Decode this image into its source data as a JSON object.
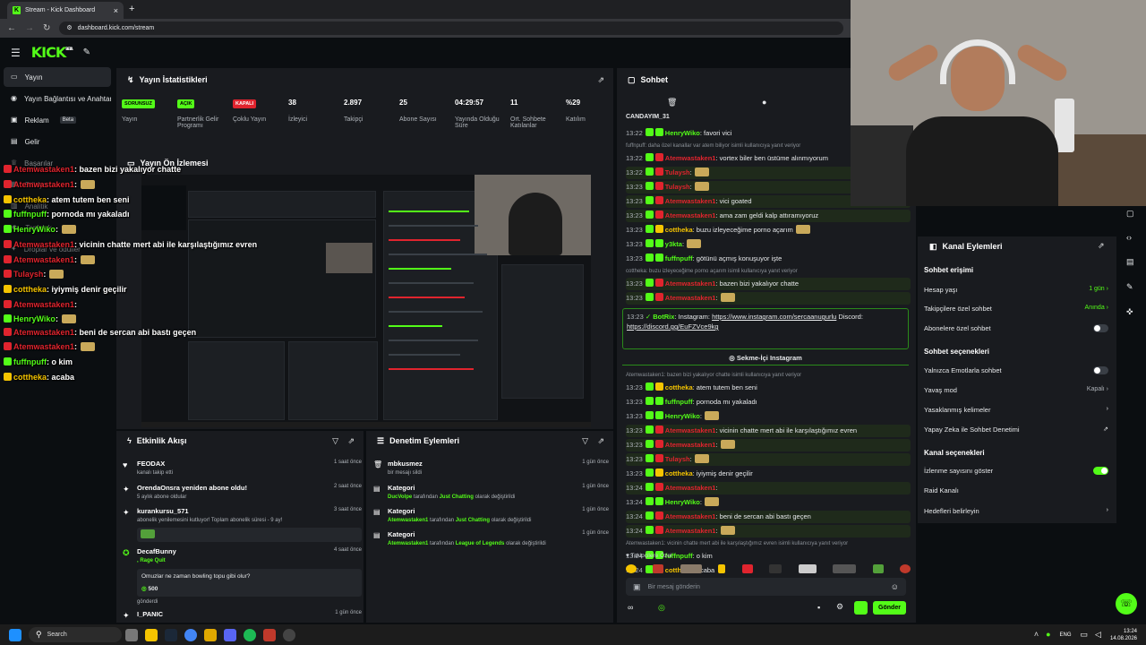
{
  "browser": {
    "tab_title": "Stream - Kick Dashboard",
    "tab_close": "×",
    "new_tab": "+",
    "url": "dashboard.kick.com/stream"
  },
  "app": {
    "logo": "KICK",
    "logo_sup": "BETA"
  },
  "sidebar": {
    "items": [
      {
        "label": "Yayın",
        "icon": "video-icon"
      },
      {
        "label": "Yayın Bağlantısı ve Anahtar",
        "icon": "broadcast-icon"
      },
      {
        "label": "Reklam",
        "icon": "ad-icon",
        "badge": "Beta"
      },
      {
        "label": "Gelir",
        "icon": "wallet-icon"
      },
      {
        "label": "Başarılar",
        "icon": "trophy-icon"
      },
      {
        "label": "Stüdyo",
        "icon": "studio-icon"
      },
      {
        "label": "Analitik",
        "icon": "chart-icon"
      },
      {
        "label": "Topluluk",
        "icon": "users-icon"
      },
      {
        "label": "Droplar ve ödüller",
        "icon": "gift-icon"
      }
    ]
  },
  "stats": {
    "title": "Yayın İstatistikleri",
    "items": [
      {
        "value": "SORUNSUZ",
        "label": "Yayın",
        "pill": true,
        "color": "#53fc18"
      },
      {
        "value": "AÇIK",
        "label": "Partnerlik Gelir Programı",
        "pill": true,
        "color": "#53fc18"
      },
      {
        "value": "KAPALI",
        "label": "Çoklu Yayın",
        "pill": true,
        "color": "#e0242e"
      },
      {
        "value": "38",
        "label": "İzleyici"
      },
      {
        "value": "2.897",
        "label": "Takipçi"
      },
      {
        "value": "25",
        "label": "Abone Sayısı"
      },
      {
        "value": "04:29:57",
        "label": "Yayında Olduğu Süre"
      },
      {
        "value": "11",
        "label": "Ort. Sohbete Katılanlar"
      },
      {
        "value": "%29",
        "label": "Katılım"
      }
    ]
  },
  "preview": {
    "title": "Yayın Ön İzlemesi"
  },
  "overlay_chat": [
    {
      "user": "Atemwastaken1",
      "color": "#e0242e",
      "text": ": bazen bizi yakalıyor chatte",
      "emote": false
    },
    {
      "user": "Atemwastaken1",
      "color": "#e0242e",
      "text": ":",
      "emote": true
    },
    {
      "user": "cottheka",
      "color": "#f5c400",
      "text": ": atem tutem ben seni",
      "emote": false
    },
    {
      "user": "fuffnpuff",
      "color": "#53fc18",
      "text": ": pornoda mı yakaladı",
      "emote": false
    },
    {
      "user": "HenryWiko",
      "color": "#53fc18",
      "text": ":",
      "emote": true
    },
    {
      "user": "Atemwastaken1",
      "color": "#e0242e",
      "text": ": vicinin chatte mert abi ile karşılaştığımız evren",
      "emote": false
    },
    {
      "user": "Atemwastaken1",
      "color": "#e0242e",
      "text": ":",
      "emote": true
    },
    {
      "user": "Tulaysh",
      "color": "#e0242e",
      "text": ":",
      "emote": true
    },
    {
      "user": "cottheka",
      "color": "#f5c400",
      "text": ": iyiymiş denir geçilir",
      "emote": false
    },
    {
      "user": "Atemwastaken1",
      "color": "#e0242e",
      "text": ":",
      "emote": false
    },
    {
      "user": "HenryWiko",
      "color": "#53fc18",
      "text": ":",
      "emote": true
    },
    {
      "user": "Atemwastaken1",
      "color": "#e0242e",
      "text": ": beni de sercan abi bastı geçen",
      "emote": false
    },
    {
      "user": "Atemwastaken1",
      "color": "#e0242e",
      "text": ":",
      "emote": true
    },
    {
      "user": "fuffnpuff",
      "color": "#53fc18",
      "text": ": o kim",
      "emote": false
    },
    {
      "user": "cottheka",
      "color": "#f5c400",
      "text": ": acaba",
      "emote": false
    }
  ],
  "activity": {
    "title": "Etkinlik Akışı",
    "items": [
      {
        "name": "FEODAX",
        "sub": "kanalı takip etti",
        "time": "1 saat önce",
        "icon": "heart-icon"
      },
      {
        "name": "OrendaOnsra yeniden abone oldu!",
        "sub": "5 aylık abone oldular",
        "time": "2 saat önce",
        "icon": "star-icon"
      },
      {
        "name": "kurankursu_571",
        "sub": "abonelik yenilemesini kutluyor! Toplam abonelik süresi - 9 ay!",
        "time": "3 saat önce",
        "icon": "star-icon"
      },
      {
        "name": "DecafBunny",
        "sub": ", Rage Quit",
        "time": "4 saat önce",
        "icon": "kick-icon",
        "quote": "Omuzlar ne zaman bowling topu gibi olur?",
        "amount": "500",
        "extra": "gönderdi"
      },
      {
        "name": "I_PANIC",
        "sub": "",
        "time": "1 gün önce",
        "icon": "star-icon"
      }
    ]
  },
  "moderation": {
    "title": "Denetim Eylemleri",
    "items": [
      {
        "name": "mbkusmez",
        "sub": "bir mesajı sildi",
        "time": "1 gün önce"
      },
      {
        "name": "Kategori",
        "by": "DucVolpe",
        "mid": " tarafından ",
        "cat": "Just Chatting",
        "end": " olarak değiştirildi",
        "time": "1 gün önce"
      },
      {
        "name": "Kategori",
        "by": "Atemwastaken1",
        "mid": " tarafından ",
        "cat": "Just Chatting",
        "end": " olarak değiştirildi",
        "time": "1 gün önce"
      },
      {
        "name": "Kategori",
        "by": "Atemwastaken1",
        "mid": " tarafından ",
        "cat": "League of Legends",
        "end": " olarak değiştirildi",
        "time": "1 gün önce"
      }
    ]
  },
  "chat": {
    "title": "Sohbet",
    "pinned_user": "CANDAYIM_31",
    "lines": [
      {
        "time": "13:22",
        "user": "HenryWiko",
        "color": "#53fc18",
        "text": ": favori vici"
      },
      {
        "reply": "fuffnpuff: daha özel kanallar var atem biliyor isimli kullanıcıya yanıt veriyor"
      },
      {
        "time": "13:22",
        "user": "Atemwastaken1",
        "color": "#e0242e",
        "text": ": vortex biler ben üstüme alınmıyorum"
      },
      {
        "time": "13:22",
        "user": "Tulaysh",
        "color": "#e0242e",
        "text": ":",
        "emote": true,
        "hl": true
      },
      {
        "time": "13:23",
        "user": "Tulaysh",
        "color": "#e0242e",
        "text": ":",
        "emote": true,
        "hl": true
      },
      {
        "time": "13:23",
        "user": "Atemwastaken1",
        "color": "#e0242e",
        "text": ": vici goated",
        "hl": true
      },
      {
        "time": "13:23",
        "user": "Atemwastaken1",
        "color": "#e0242e",
        "text": ": ama zam geldi kalp attıramıyoruz",
        "hl": true
      },
      {
        "time": "13:23",
        "user": "cottheka",
        "color": "#f5c400",
        "text": ": buzu izleyeceğime porno açarım",
        "emote": true
      },
      {
        "time": "13:23",
        "user": "y3kta",
        "color": "#53fc18",
        "text": ":",
        "emote": true
      },
      {
        "time": "13:23",
        "user": "fuffnpuff",
        "color": "#53fc18",
        "text": ": götünü açmış konuşuyor işte"
      },
      {
        "reply": "cottheka: buzu izleyeceğime porno açarım isimli kullanıcıya yanıt veriyor"
      },
      {
        "time": "13:23",
        "user": "Atemwastaken1",
        "color": "#e0242e",
        "text": ": bazen bizi yakalıyor chatte",
        "hl": true
      },
      {
        "time": "13:23",
        "user": "Atemwastaken1",
        "color": "#e0242e",
        "text": ":",
        "emote": true,
        "hl": true
      }
    ],
    "bot_user": "BotRix",
    "bot_text": ": Instagram: ",
    "bot_link1": "https://www.instagram.com/sercaanugurlu",
    "bot_text2": " Discord:",
    "bot_link2": "https://discord.gg/EuFZVce9kg",
    "bot_time": "13:23",
    "instagram_btn": "Sekme-İçi Instagram",
    "lines2": [
      {
        "reply": "Atemwastaken1: bazen bizi yakalıyor chatte isimli kullanıcıya yanıt veriyor"
      },
      {
        "time": "13:23",
        "user": "cottheka",
        "color": "#f5c400",
        "text": ": atem tutem ben seni"
      },
      {
        "time": "13:23",
        "user": "fuffnpuff",
        "color": "#53fc18",
        "text": ": pornoda mı yakaladı"
      },
      {
        "time": "13:23",
        "user": "HenryWiko",
        "color": "#53fc18",
        "text": ":",
        "emote": true
      },
      {
        "time": "13:23",
        "user": "Atemwastaken1",
        "color": "#e0242e",
        "text": ": vicinin chatte mert abi ile karşılaştığımız evren",
        "hl": true
      },
      {
        "time": "13:23",
        "user": "Atemwastaken1",
        "color": "#e0242e",
        "text": ":",
        "emote": true,
        "hl": true
      },
      {
        "time": "13:23",
        "user": "Tulaysh",
        "color": "#e0242e",
        "text": ":",
        "emote": true,
        "hl": true
      },
      {
        "time": "13:23",
        "user": "cottheka",
        "color": "#f5c400",
        "text": ": iyiymiş denir geçilir"
      },
      {
        "time": "13:24",
        "user": "Atemwastaken1",
        "color": "#e0242e",
        "text": ":",
        "hl": true
      },
      {
        "time": "13:24",
        "user": "HenryWiko",
        "color": "#53fc18",
        "text": ":",
        "emote": true
      },
      {
        "time": "13:24",
        "user": "Atemwastaken1",
        "color": "#e0242e",
        "text": ": beni de sercan abi bastı geçen",
        "hl": true
      },
      {
        "time": "13:24",
        "user": "Atemwastaken1",
        "color": "#e0242e",
        "text": ":",
        "emote": true,
        "hl": true
      },
      {
        "reply": "Atemwastaken1: vicinin chatte mert abi ile karşılaştığımız evren isimli kullanıcıya yanıt veriyor"
      },
      {
        "time": "13:24",
        "user": "fuffnpuff",
        "color": "#53fc18",
        "text": ": o kim"
      },
      {
        "time": "13:24",
        "user": "cottheka",
        "color": "#f5c400",
        "text": ": acaba"
      }
    ],
    "follower_label": "Takipçilere Özel",
    "input_placeholder": "Bir mesaj gönderin",
    "send_label": "Gönder"
  },
  "channel": {
    "title": "Kanal Eylemleri",
    "sec_access": "Sohbet erişimi",
    "account_age": "Hesap yaşı",
    "account_age_val": "1 gün",
    "followers_only": "Takipçilere özel sohbet",
    "followers_only_val": "Anında",
    "subs_only": "Abonelere özel sohbet",
    "sec_options": "Sohbet seçenekleri",
    "emote_only": "Yalnızca Emotlarla sohbet",
    "slow_mode": "Yavaş mod",
    "slow_mode_val": "Kapalı",
    "banned_words": "Yasaklanmış kelimeler",
    "ai_mod": "Yapay Zeka ile Sohbet Denetimi",
    "sec_channel": "Kanal seçenekleri",
    "show_viewers": "İzlenme sayısını göster",
    "raid": "Raid Kanalı",
    "goals": "Hedefleri belirleyin"
  },
  "taskbar": {
    "search": "Search",
    "lang": "ENG",
    "time": "13:24",
    "date": "14.08.2026"
  },
  "colors": {
    "accent": "#53fc18",
    "danger": "#e0242e"
  }
}
